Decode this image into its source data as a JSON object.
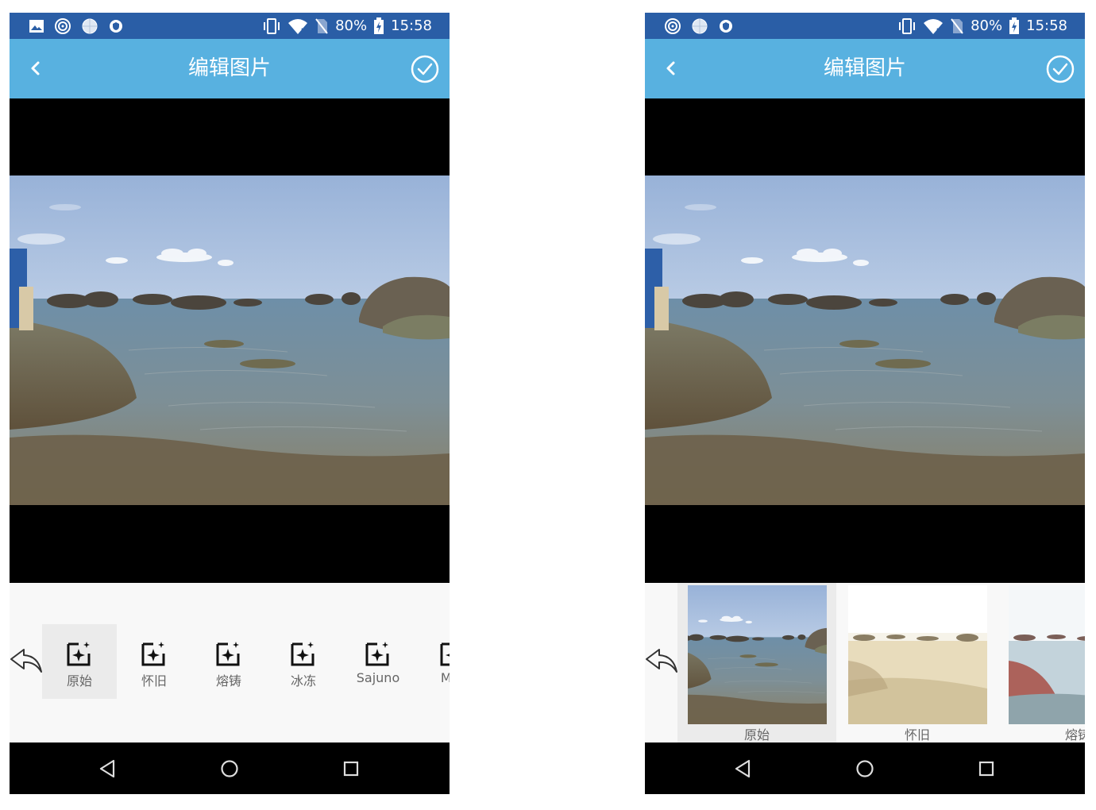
{
  "status_bar": {
    "battery": "80%",
    "time": "15:58",
    "left_icons_phone1": [
      "image-icon",
      "spiral-icon",
      "globe-icon",
      "shield-icon"
    ],
    "left_icons_phone2": [
      "spiral-icon",
      "globe-icon",
      "shield-icon"
    ],
    "right_icons": [
      "vibrate-icon",
      "wifi-icon",
      "no-sim-icon",
      "battery-charging-icon"
    ]
  },
  "app_bar": {
    "title": "编辑图片",
    "back_icon": "chevron-left-icon",
    "confirm_icon": "check-circle-icon"
  },
  "filter_icon_panel": {
    "undo_icon": "undo-arrow-icon",
    "filters": [
      {
        "label": "原始",
        "icon": "sparkle-frame-icon",
        "selected": true
      },
      {
        "label": "怀旧",
        "icon": "sparkle-frame-icon",
        "selected": false
      },
      {
        "label": "熔铸",
        "icon": "sparkle-frame-icon",
        "selected": false
      },
      {
        "label": "冰冻",
        "icon": "sparkle-frame-icon",
        "selected": false
      },
      {
        "label": "Sajuno",
        "icon": "sparkle-frame-icon",
        "selected": false
      },
      {
        "label": "Mar",
        "icon": "sparkle-frame-icon",
        "selected": false
      }
    ]
  },
  "filter_thumb_panel": {
    "undo_icon": "undo-arrow-icon",
    "filters": [
      {
        "label": "原始",
        "style": "original",
        "selected": true
      },
      {
        "label": "怀旧",
        "style": "nostalgia",
        "selected": false
      },
      {
        "label": "熔铸",
        "style": "cast",
        "selected": false
      }
    ]
  },
  "nav_bar": {
    "back": "triangle-back-icon",
    "home": "circle-home-icon",
    "recents": "square-recents-icon"
  },
  "colors": {
    "status_bar": "#2a5ea6",
    "app_bar": "#58b1e0",
    "panel_bg": "#f8f8f8",
    "selected_bg": "#ebebeb"
  }
}
